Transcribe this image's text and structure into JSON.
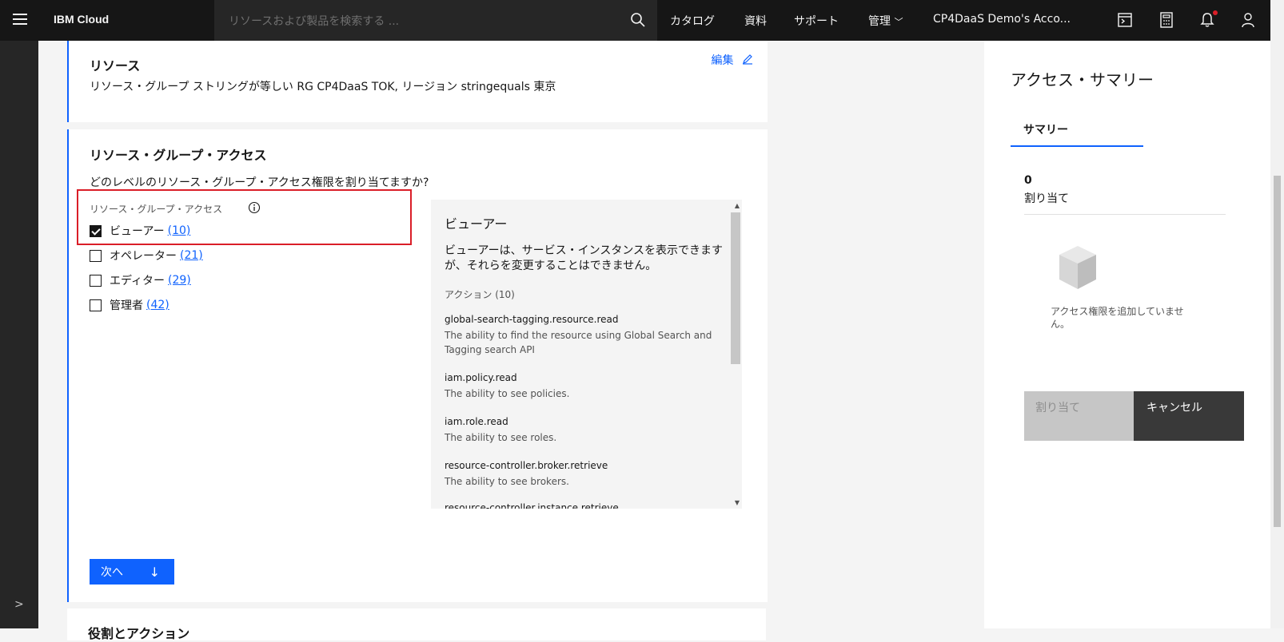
{
  "header": {
    "brand": "IBM Cloud",
    "search_placeholder": "リソースおよび製品を検索する ...",
    "nav": [
      "カタログ",
      "資料",
      "サポート",
      "管理"
    ],
    "account": "CP4DaaS Demo's Acco..."
  },
  "resource": {
    "title": "リソース",
    "edit_label": "編集",
    "description": "リソース・グループ ストリングが等しい RG CP4DaaS TOK, リージョン stringequals 東京"
  },
  "rg_access": {
    "title": "リソース・グループ・アクセス",
    "question": "どのレベルのリソース・グループ・アクセス権限を割り当てますか?",
    "field_label": "リソース・グループ・アクセス",
    "roles": [
      {
        "label": "ビューアー",
        "count": "(10)",
        "checked": true
      },
      {
        "label": "オペレーター",
        "count": "(21)",
        "checked": false
      },
      {
        "label": "エディター",
        "count": "(29)",
        "checked": false
      },
      {
        "label": "管理者",
        "count": "(42)",
        "checked": false
      }
    ],
    "next_label": "次へ"
  },
  "detail": {
    "title": "ビューアー",
    "description": "ビューアーは、サービス・インスタンスを表示できますが、それらを変更することはできません。",
    "actions_label": "アクション (10)",
    "actions": [
      {
        "name": "global-search-tagging.resource.read",
        "desc": "The ability to find the resource using Global Search and Tagging search API"
      },
      {
        "name": "iam.policy.read",
        "desc": "The ability to see policies."
      },
      {
        "name": "iam.role.read",
        "desc": "The ability to see roles."
      },
      {
        "name": "resource-controller.broker.retrieve",
        "desc": "The ability to see brokers."
      },
      {
        "name": "resource-controller.instance.retrieve",
        "desc": ""
      }
    ]
  },
  "next_section": {
    "title": "役割とアクション"
  },
  "summary": {
    "title": "アクセス・サマリー",
    "tab": "サマリー",
    "count": "0",
    "count_label": "割り当て",
    "empty_message": "アクセス権限を追加していません。",
    "assign_label": "割り当て",
    "cancel_label": "キャンセル"
  },
  "colors": {
    "accent": "#0f62fe",
    "header_bg": "#161616",
    "highlight": "#da1e28"
  }
}
